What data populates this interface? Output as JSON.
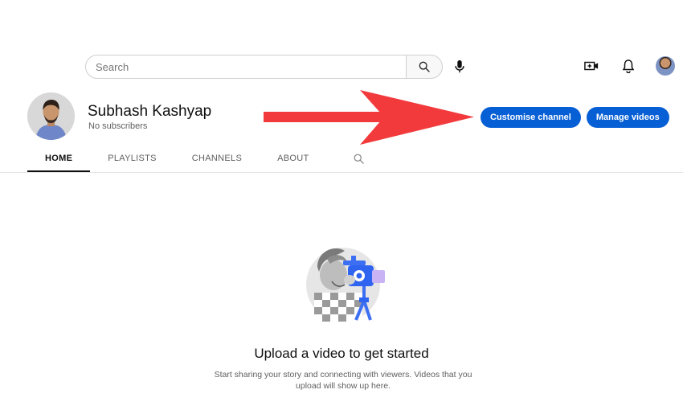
{
  "search": {
    "placeholder": "Search",
    "search_icon": "search-icon",
    "mic_icon": "microphone-icon"
  },
  "topbar": {
    "create_icon": "create-video-icon",
    "notifications_icon": "bell-icon",
    "avatar_icon": "account-avatar"
  },
  "channel": {
    "name": "Subhash Kashyap",
    "subscribers": "No subscribers",
    "customise_label": "Customise channel",
    "manage_label": "Manage videos",
    "accent_color": "#065fd4",
    "arrow_color": "#f23a3c"
  },
  "tabs": [
    {
      "label": "HOME",
      "active": true
    },
    {
      "label": "PLAYLISTS",
      "active": false
    },
    {
      "label": "CHANNELS",
      "active": false
    },
    {
      "label": "ABOUT",
      "active": false
    }
  ],
  "empty_state": {
    "title": "Upload a video to get started",
    "description": "Start sharing your story and connecting with viewers. Videos that you upload will show up here."
  }
}
